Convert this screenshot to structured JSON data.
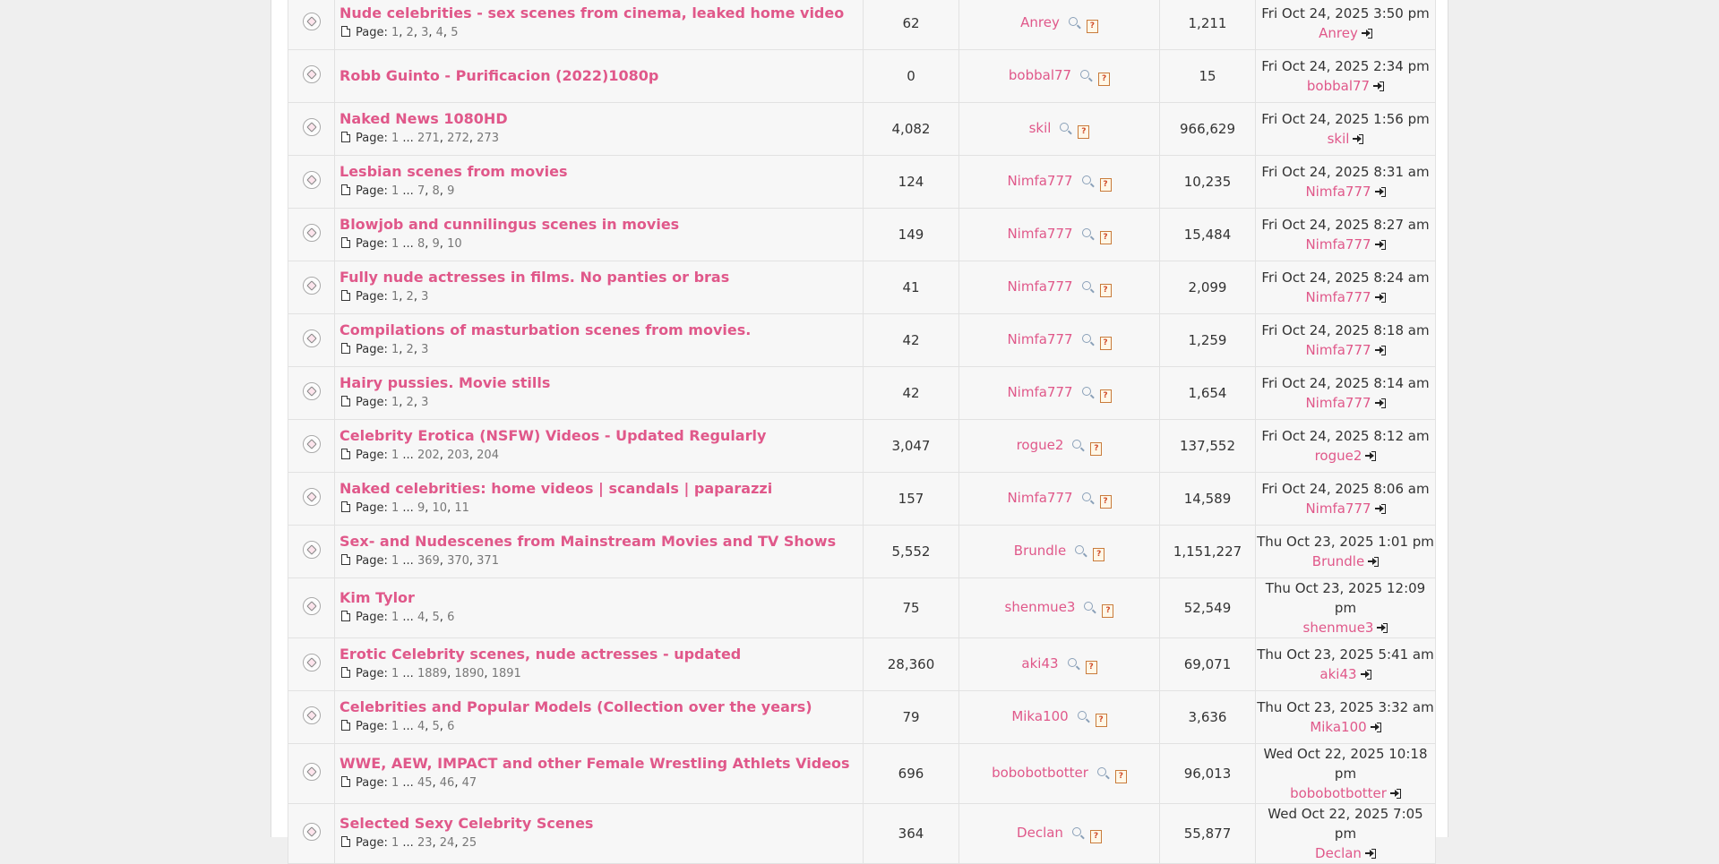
{
  "topics": [
    {
      "title": "Nude celebrities - sex scenes from cinema, leaked home video",
      "pages": [
        "1",
        "2",
        "3",
        "4",
        "5"
      ],
      "ellipsis": false,
      "replies": "62",
      "author": "Anrey",
      "views": "1,211",
      "last_date": "Fri Oct 24, 2025 3:50 pm",
      "last_user": "Anrey"
    },
    {
      "title": "Robb Guinto - Purificacion (2022)1080p",
      "pages": [],
      "ellipsis": false,
      "replies": "0",
      "author": "bobbal77",
      "views": "15",
      "last_date": "Fri Oct 24, 2025 2:34 pm",
      "last_user": "bobbal77"
    },
    {
      "title": "Naked News 1080HD",
      "pages": [
        "1",
        "271",
        "272",
        "273"
      ],
      "ellipsis": true,
      "replies": "4,082",
      "author": "skil",
      "views": "966,629",
      "last_date": "Fri Oct 24, 2025 1:56 pm",
      "last_user": "skil"
    },
    {
      "title": "Lesbian scenes from movies",
      "pages": [
        "1",
        "7",
        "8",
        "9"
      ],
      "ellipsis": true,
      "replies": "124",
      "author": "Nimfa777",
      "views": "10,235",
      "last_date": "Fri Oct 24, 2025 8:31 am",
      "last_user": "Nimfa777"
    },
    {
      "title": "Blowjob and cunnilingus scenes in movies",
      "pages": [
        "1",
        "8",
        "9",
        "10"
      ],
      "ellipsis": true,
      "replies": "149",
      "author": "Nimfa777",
      "views": "15,484",
      "last_date": "Fri Oct 24, 2025 8:27 am",
      "last_user": "Nimfa777"
    },
    {
      "title": "Fully nude actresses in films. No panties or bras",
      "pages": [
        "1",
        "2",
        "3"
      ],
      "ellipsis": false,
      "replies": "41",
      "author": "Nimfa777",
      "views": "2,099",
      "last_date": "Fri Oct 24, 2025 8:24 am",
      "last_user": "Nimfa777"
    },
    {
      "title": "Compilations of masturbation scenes from movies.",
      "pages": [
        "1",
        "2",
        "3"
      ],
      "ellipsis": false,
      "replies": "42",
      "author": "Nimfa777",
      "views": "1,259",
      "last_date": "Fri Oct 24, 2025 8:18 am",
      "last_user": "Nimfa777"
    },
    {
      "title": "Hairy pussies. Movie stills",
      "pages": [
        "1",
        "2",
        "3"
      ],
      "ellipsis": false,
      "replies": "42",
      "author": "Nimfa777",
      "views": "1,654",
      "last_date": "Fri Oct 24, 2025 8:14 am",
      "last_user": "Nimfa777"
    },
    {
      "title": "Celebrity Erotica (NSFW) Videos - Updated Regularly",
      "pages": [
        "1",
        "202",
        "203",
        "204"
      ],
      "ellipsis": true,
      "replies": "3,047",
      "author": "rogue2",
      "views": "137,552",
      "last_date": "Fri Oct 24, 2025 8:12 am",
      "last_user": "rogue2"
    },
    {
      "title": "Naked celebrities: home videos | scandals | paparazzi",
      "pages": [
        "1",
        "9",
        "10",
        "11"
      ],
      "ellipsis": true,
      "replies": "157",
      "author": "Nimfa777",
      "views": "14,589",
      "last_date": "Fri Oct 24, 2025 8:06 am",
      "last_user": "Nimfa777"
    },
    {
      "title": "Sex- and Nudescenes from Mainstream Movies and TV Shows",
      "pages": [
        "1",
        "369",
        "370",
        "371"
      ],
      "ellipsis": true,
      "replies": "5,552",
      "author": "Brundle",
      "views": "1,151,227",
      "last_date": "Thu Oct 23, 2025 1:01 pm",
      "last_user": "Brundle"
    },
    {
      "title": "Kim Tylor",
      "pages": [
        "1",
        "4",
        "5",
        "6"
      ],
      "ellipsis": true,
      "replies": "75",
      "author": "shenmue3",
      "views": "52,549",
      "last_date": "Thu Oct 23, 2025 12:09 pm",
      "last_user": "shenmue3"
    },
    {
      "title": "Erotic Celebrity scenes, nude actresses - updated",
      "pages": [
        "1",
        "1889",
        "1890",
        "1891"
      ],
      "ellipsis": true,
      "replies": "28,360",
      "author": "aki43",
      "views": "69,071",
      "last_date": "Thu Oct 23, 2025 5:41 am",
      "last_user": "aki43"
    },
    {
      "title": "Celebrities and Popular Models (Collection over the years)",
      "pages": [
        "1",
        "4",
        "5",
        "6"
      ],
      "ellipsis": true,
      "replies": "79",
      "author": "Mika100",
      "views": "3,636",
      "last_date": "Thu Oct 23, 2025 3:32 am",
      "last_user": "Mika100"
    },
    {
      "title": "WWE, AEW, IMPACT and other Female Wrestling Athlets Videos",
      "pages": [
        "1",
        "45",
        "46",
        "47"
      ],
      "ellipsis": true,
      "replies": "696",
      "author": "bobobotbotter",
      "views": "96,013",
      "last_date": "Wed Oct 22, 2025 10:18 pm",
      "last_user": "bobobotbotter"
    },
    {
      "title": "Selected Sexy Celebrity Scenes",
      "pages": [
        "1",
        "23",
        "24",
        "25"
      ],
      "ellipsis": true,
      "replies": "364",
      "author": "Declan",
      "views": "55,877",
      "last_date": "Wed Oct 22, 2025 7:05 pm",
      "last_user": "Declan"
    }
  ],
  "labels": {
    "page_prefix": "Page:",
    "ellipsis": "..."
  }
}
